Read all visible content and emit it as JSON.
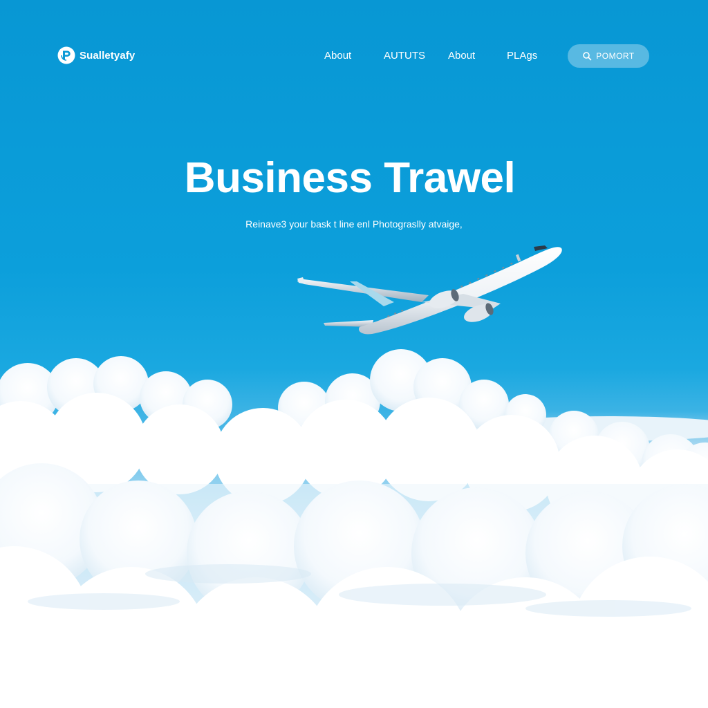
{
  "brand": {
    "name": "Sualletyafy",
    "logo_icon": "p-circle-logo-icon"
  },
  "nav": {
    "items": [
      {
        "label": "About"
      },
      {
        "label": "AUTUTS"
      },
      {
        "label": "About"
      },
      {
        "label": "PLAgs"
      }
    ],
    "search": {
      "label": "POMORT",
      "icon": "search-icon"
    }
  },
  "hero": {
    "title": "Business Trawel",
    "subtitle": "Reinave3 your bask t line enl Photograslly atvaige,"
  },
  "colors": {
    "sky": "#0a9ad6",
    "text": "#ffffff",
    "cloud": "#ffffff"
  }
}
